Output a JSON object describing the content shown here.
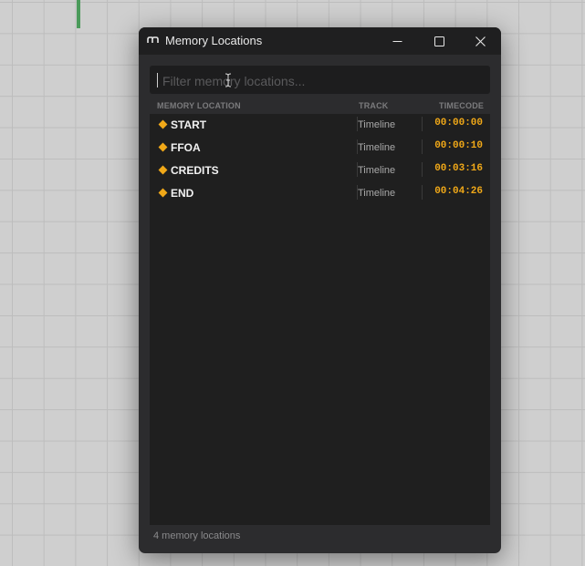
{
  "window": {
    "title": "Memory Locations",
    "icon": "app-logo-icon"
  },
  "filter": {
    "value": "",
    "placeholder": "Filter memory locations..."
  },
  "columns": {
    "location": "MEMORY LOCATION",
    "track": "TRACK",
    "timecode": "TIMECODE"
  },
  "locations": [
    {
      "name": "START",
      "track": "Timeline",
      "timecode": "00:00:00"
    },
    {
      "name": "FFOA",
      "track": "Timeline",
      "timecode": "00:00:10"
    },
    {
      "name": "CREDITS",
      "track": "Timeline",
      "timecode": "00:03:16"
    },
    {
      "name": "END",
      "track": "Timeline",
      "timecode": "00:04:26"
    }
  ],
  "footer": {
    "count_text": "4 memory locations"
  },
  "colors": {
    "accent": "#f0a818",
    "window_bg": "#2c2c2e",
    "titlebar_bg": "#1f1f20",
    "list_bg": "#1f1f1f"
  }
}
